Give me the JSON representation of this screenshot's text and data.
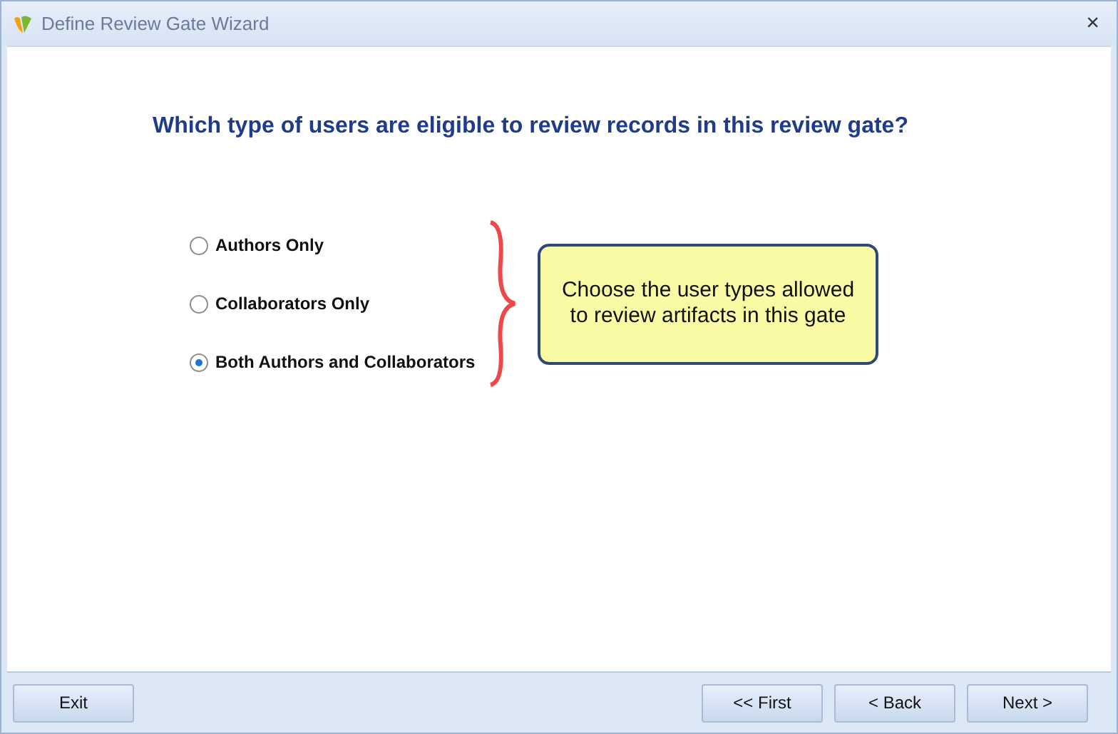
{
  "window": {
    "title": "Define Review Gate Wizard",
    "close": "×"
  },
  "question": "Which type of users are eligible to review records in this review gate?",
  "options": [
    {
      "label": "Authors Only",
      "selected": false
    },
    {
      "label": "Collaborators Only",
      "selected": false
    },
    {
      "label": "Both Authors and Collaborators",
      "selected": true
    }
  ],
  "callout": "Choose the user types allowed to review artifacts in this gate",
  "buttons": {
    "left": [
      "Exit"
    ],
    "right": [
      "<< First",
      "< Back",
      "Next >"
    ]
  }
}
